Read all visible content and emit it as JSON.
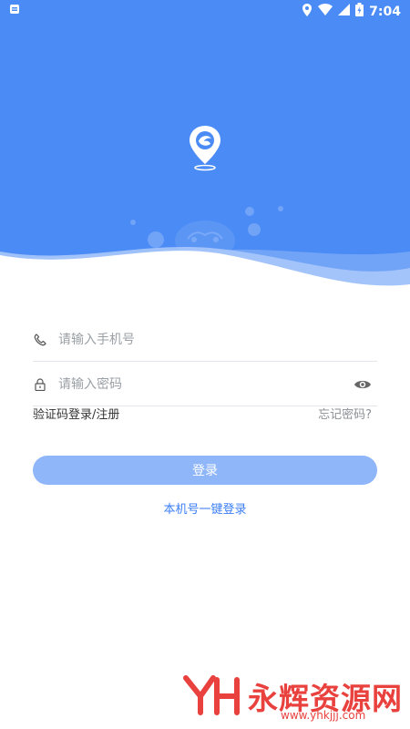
{
  "status_bar": {
    "time": "7:04"
  },
  "form": {
    "phone_placeholder": "请输入手机号",
    "password_placeholder": "请输入密码"
  },
  "links": {
    "sms_login_register": "验证码登录/注册",
    "forgot_password": "忘记密码?"
  },
  "buttons": {
    "login": "登录",
    "one_key_login": "本机号一键登录"
  },
  "watermark": {
    "title": "永辉资源网",
    "url": "www.yhkjjj.com"
  },
  "colors": {
    "hero_blue": "#4a8bf5",
    "button_disabled": "#8fb6f9",
    "link_blue": "#3b7ef5",
    "watermark_red": "#e8413e"
  }
}
